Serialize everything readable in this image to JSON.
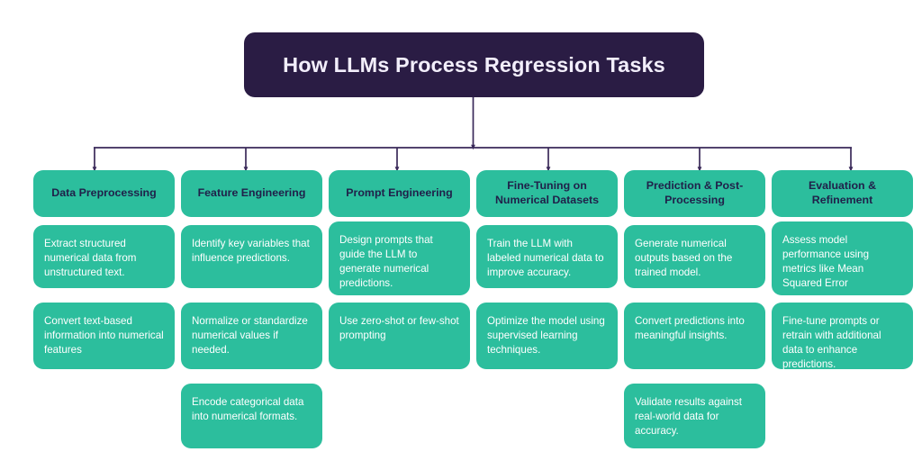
{
  "title": {
    "text": "How LLMs Process Regression Tasks",
    "bg_color": "#2a1c44",
    "text_color": "#f2eefb"
  },
  "theme": {
    "node_color": "#2cbe9d",
    "node_text_color": "#ffffff",
    "header_text_color": "#20214a",
    "connector_color": "#3a2a5a",
    "background": "#ffffff"
  },
  "columns": [
    {
      "header": "Data Preprocessing",
      "items": [
        "Extract structured numerical data from unstructured text.",
        "Convert text-based information into numerical features"
      ]
    },
    {
      "header": "Feature Engineering",
      "items": [
        "Identify key variables that influence predictions.",
        "Normalize or standardize numerical values if needed.",
        "Encode categorical data into numerical formats."
      ]
    },
    {
      "header": "Prompt Engineering",
      "items": [
        " Design prompts that guide the LLM to generate numerical predictions.",
        "Use zero-shot or few-shot prompting"
      ]
    },
    {
      "header": "Fine-Tuning on Numerical Datasets",
      "items": [
        "Train the LLM with labeled numerical data to improve accuracy.",
        "Optimize the model using supervised learning techniques."
      ]
    },
    {
      "header": "Prediction & Post-Processing",
      "items": [
        "Generate numerical outputs based on the trained model.",
        "Convert predictions into meaningful insights.",
        "Validate results against real-world data for accuracy."
      ]
    },
    {
      "header": "Evaluation & Refinement",
      "items": [
        "Assess model performance using metrics like Mean Squared Error",
        "Fine-tune prompts or retrain with additional data to enhance predictions."
      ]
    }
  ]
}
